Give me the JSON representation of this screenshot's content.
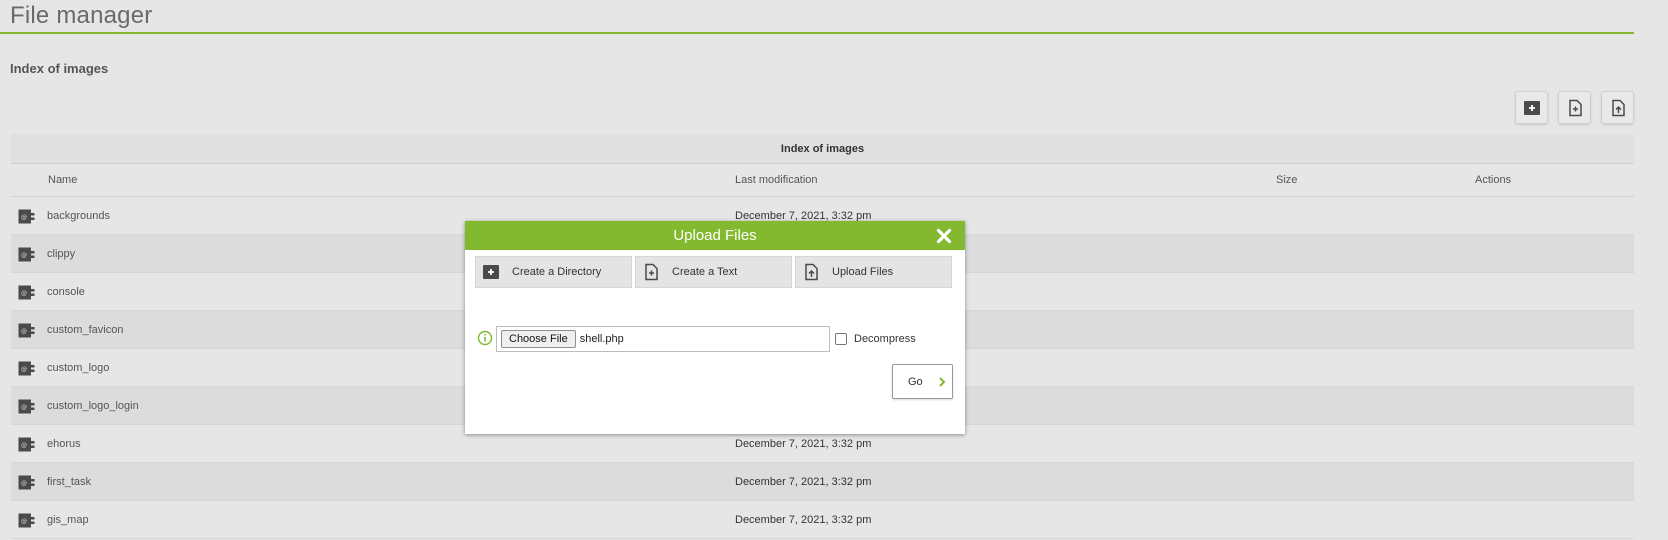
{
  "page": {
    "title": "File manager",
    "section_title": "Index of images"
  },
  "colors": {
    "accent": "#82b92e",
    "icon_dark": "#4a4a4a"
  },
  "toolbar": {
    "buttons": [
      {
        "icon": "create-directory-icon"
      },
      {
        "icon": "create-text-icon"
      },
      {
        "icon": "upload-files-icon"
      }
    ]
  },
  "table": {
    "caption": "Index of images",
    "columns": [
      "Name",
      "Last modification",
      "Size",
      "Actions"
    ],
    "rows": [
      {
        "name": "backgrounds",
        "modified": "December 7, 2021, 3:32 pm"
      },
      {
        "name": "clippy",
        "modified": ""
      },
      {
        "name": "console",
        "modified": ""
      },
      {
        "name": "custom_favicon",
        "modified": ""
      },
      {
        "name": "custom_logo",
        "modified": ""
      },
      {
        "name": "custom_logo_login",
        "modified": ""
      },
      {
        "name": "ehorus",
        "modified": "December 7, 2021, 3:32 pm"
      },
      {
        "name": "first_task",
        "modified": "December 7, 2021, 3:32 pm"
      },
      {
        "name": "gis_map",
        "modified": "December 7, 2021, 3:32 pm"
      }
    ]
  },
  "modal": {
    "title": "Upload Files",
    "tabs": [
      {
        "label": "Create a Directory",
        "icon": "create-directory-icon"
      },
      {
        "label": "Create a Text",
        "icon": "create-text-icon"
      },
      {
        "label": "Upload Files",
        "icon": "upload-files-icon"
      }
    ],
    "choose_button": "Choose File",
    "file_name": "shell.php",
    "decompress_label": "Decompress",
    "decompress_checked": false,
    "go_label": "Go"
  }
}
